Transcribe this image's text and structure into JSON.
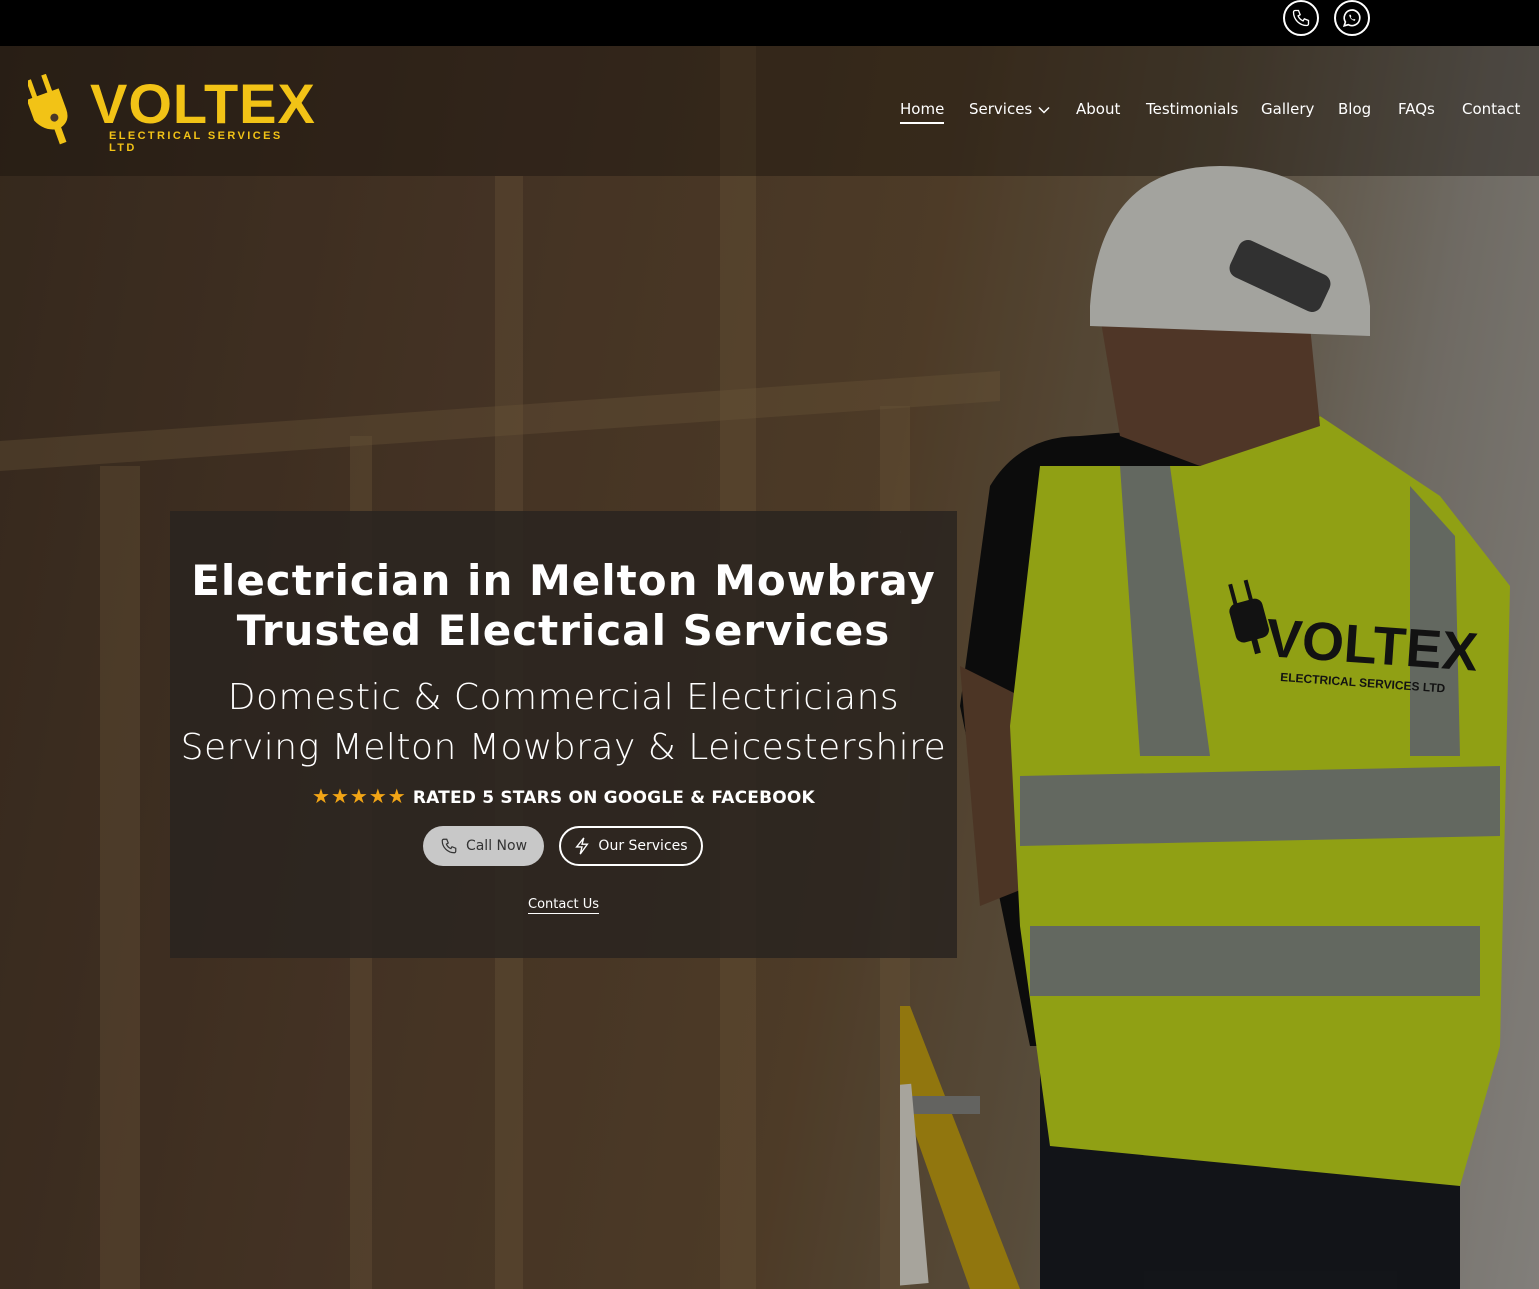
{
  "topbar": {
    "icons": [
      "phone-icon",
      "whatsapp-icon"
    ]
  },
  "logo": {
    "word": "VOLTEX",
    "subtitle": "ELECTRICAL SERVICES LTD",
    "brand_color": "#f2c316"
  },
  "nav": {
    "items": [
      {
        "label": "Home",
        "active": true
      },
      {
        "label": "Services",
        "dropdown": true
      },
      {
        "label": "About"
      },
      {
        "label": "Testimonials"
      },
      {
        "label": "Gallery"
      },
      {
        "label": "Blog"
      },
      {
        "label": "FAQs"
      },
      {
        "label": "Contact"
      }
    ]
  },
  "hero": {
    "title_line1": "Electrician in Melton Mowbray",
    "title_line2": "Trusted Electrical Services",
    "subtitle_line1": "Domestic & Commercial Electricians",
    "subtitle_line2": "Serving Melton Mowbray & Leicestershire",
    "stars": "★★★★★",
    "rating_text": "RATED 5 STARS ON GOOGLE & FACEBOOK",
    "call_label": "Call Now",
    "services_label": "Our Services",
    "contact_label": "Contact Us",
    "vest_logo": "VOLTEX",
    "vest_sub": "ELECTRICAL SERVICES LTD"
  }
}
